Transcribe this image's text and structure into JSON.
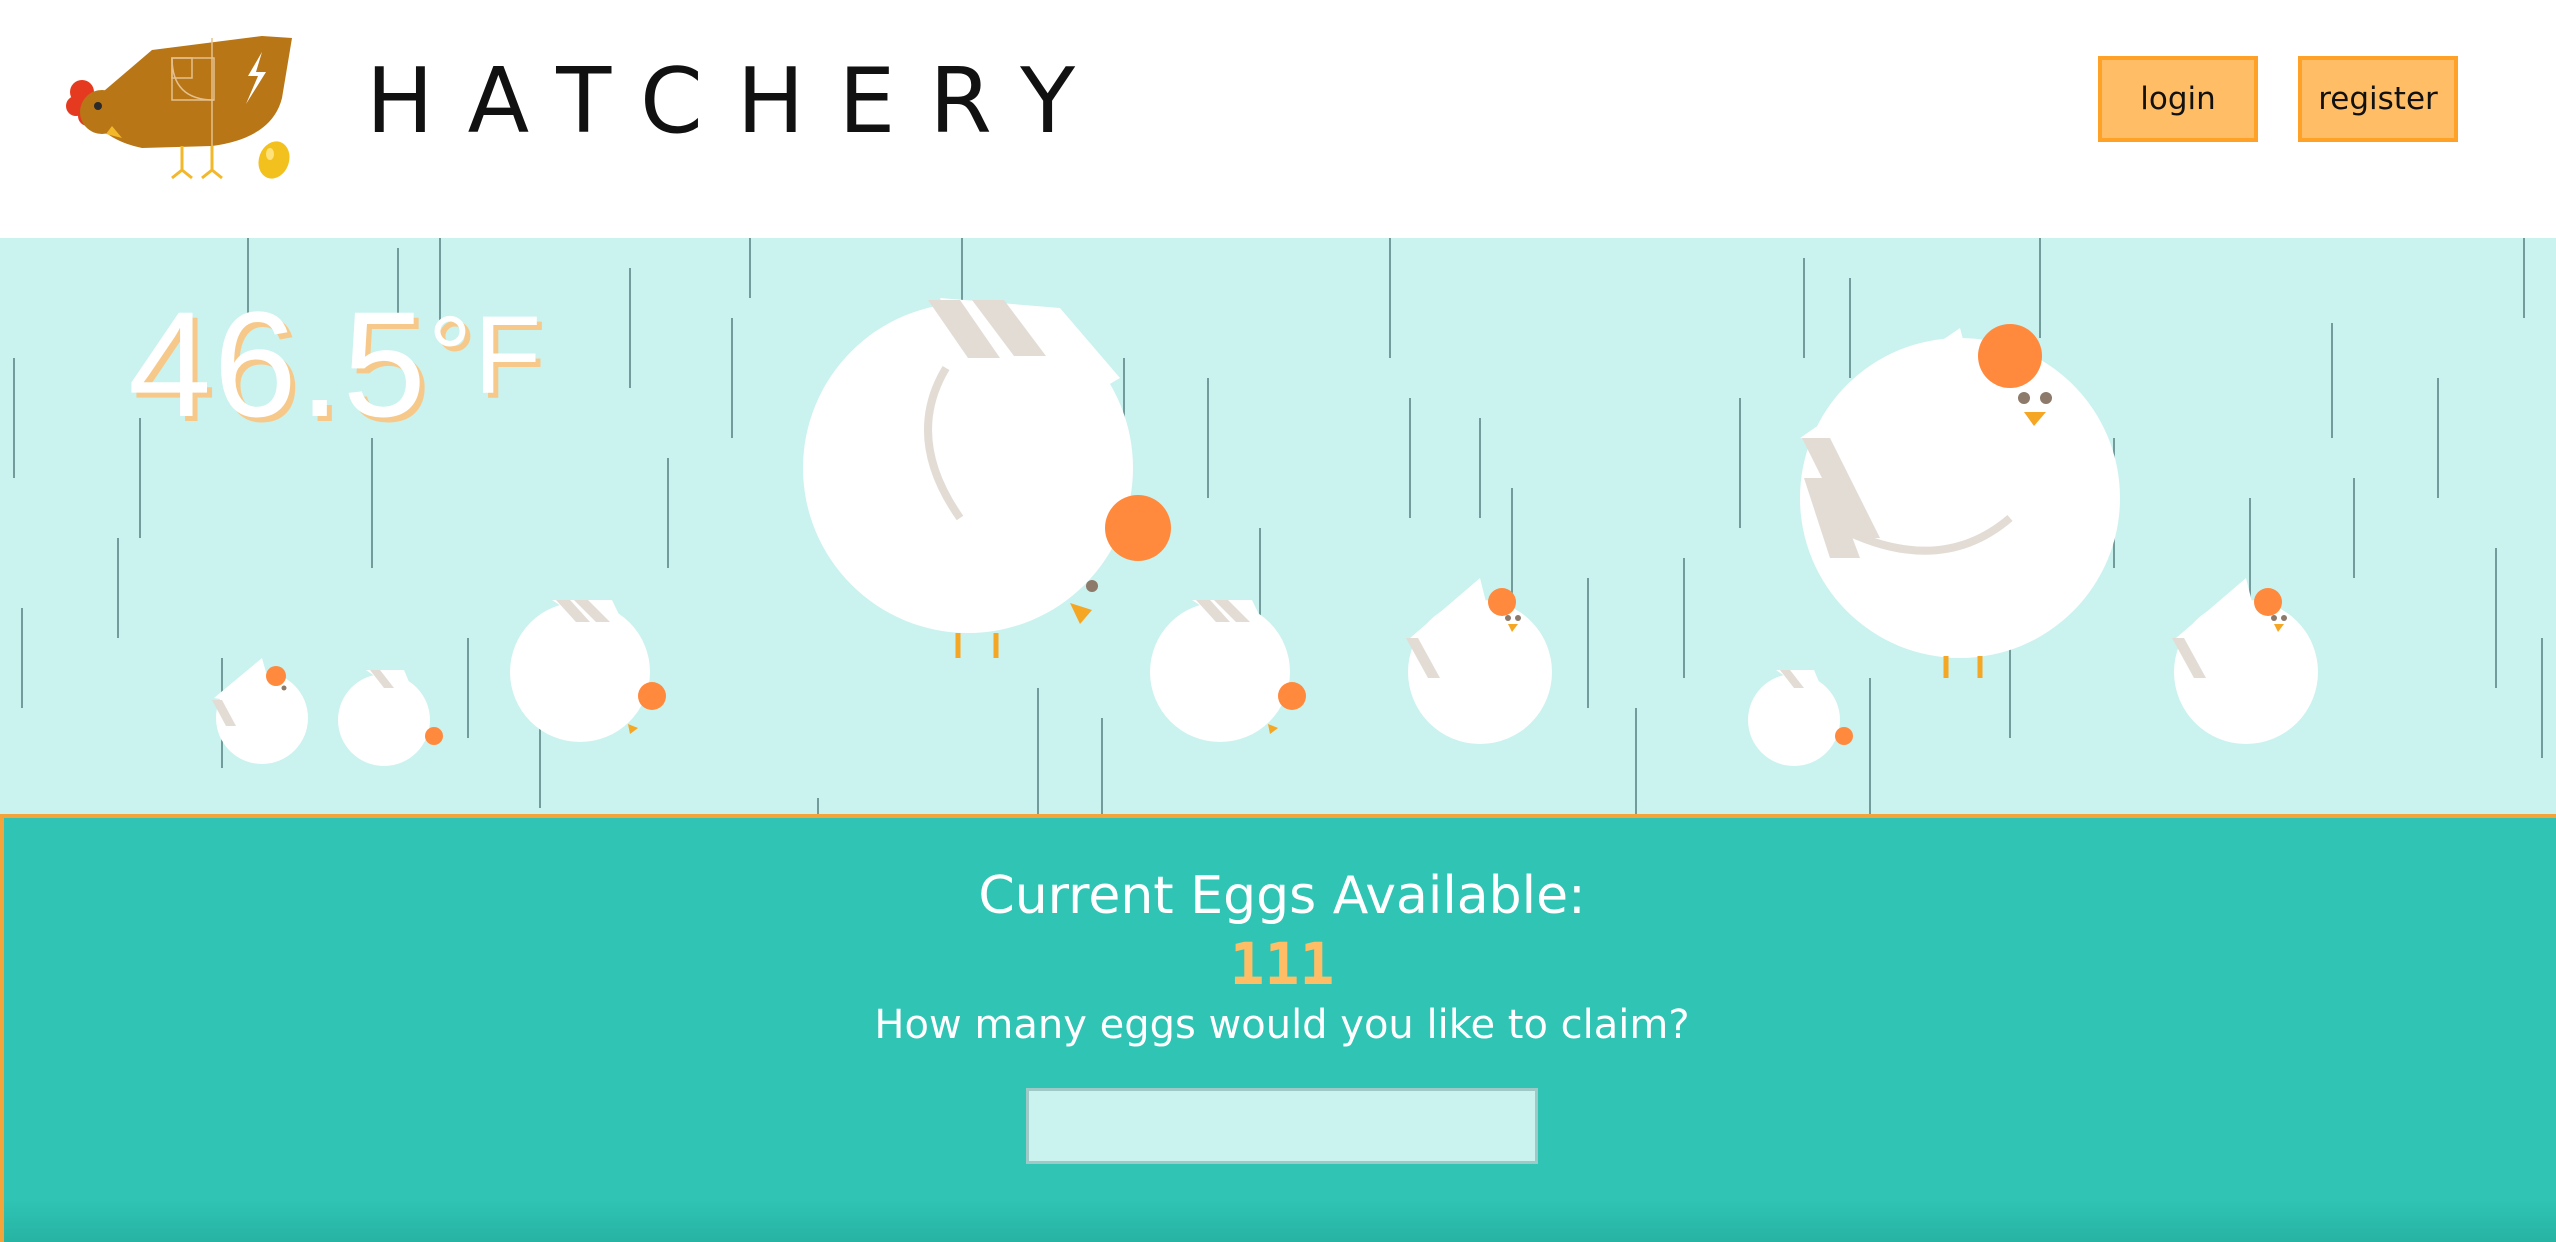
{
  "header": {
    "brand": "HATCHERY",
    "login_label": "login",
    "register_label": "register"
  },
  "weather": {
    "temperature": "46.5",
    "unit": "°F",
    "condition_icon": "rain"
  },
  "claim": {
    "title": "Current Eggs Available:",
    "eggs_available": "111",
    "question": "How many eggs would you like to claim?",
    "input_value": "",
    "input_placeholder": ""
  },
  "colors": {
    "accent": "#ffbe66",
    "accent_border": "#ffa126",
    "sky": "#caf2ef",
    "panel": "#2fc4b4",
    "chicken_comb": "#ff8a3d",
    "hen_brown": "#b87616"
  }
}
